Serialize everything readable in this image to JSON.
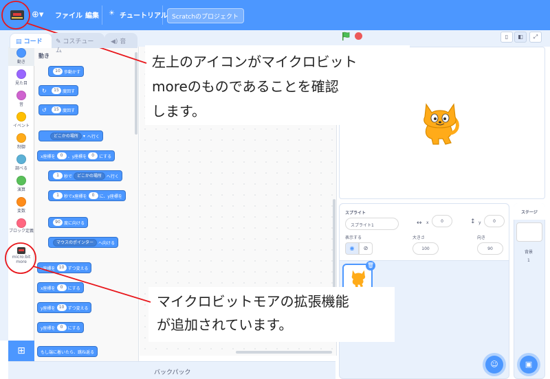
{
  "menubar": {
    "file": "ファイル",
    "edit": "編集",
    "tutorials": "チュートリアル",
    "project_title": "Scratchのプロジェクト",
    "lang_icon": "globe-icon"
  },
  "tabs": {
    "code": "コード",
    "costumes": "コスチューム",
    "sounds": "音"
  },
  "categories": [
    {
      "label": "動き",
      "color": "#4c97ff"
    },
    {
      "label": "見た目",
      "color": "#9966ff"
    },
    {
      "label": "音",
      "color": "#cf63cf"
    },
    {
      "label": "イベント",
      "color": "#ffbf00"
    },
    {
      "label": "制御",
      "color": "#ffab19"
    },
    {
      "label": "調べる",
      "color": "#5cb1d6"
    },
    {
      "label": "演算",
      "color": "#59c059"
    },
    {
      "label": "変数",
      "color": "#ff8c1a"
    },
    {
      "label": "ブロック定義",
      "color": "#ff6680"
    }
  ],
  "extension_category": {
    "label": "micro:bit more",
    "note": "micro:bit more"
  },
  "palette": {
    "heading": "動き",
    "blocks": {
      "move_steps": {
        "value": "10",
        "text": "歩動かす"
      },
      "turn_right": {
        "value": "15",
        "text": "度回す"
      },
      "turn_left": {
        "value": "15",
        "text": "度回す"
      },
      "goto": {
        "dropdown": "どこかの場所",
        "text": "へ行く"
      },
      "goto_xy": {
        "x_label": "x座標を",
        "x": "0",
        "sep": "、y座標を",
        "y": "0",
        "text": "にする"
      },
      "glide": {
        "secs": "1",
        "t1": "秒で",
        "dropdown": "どこかの場所",
        "t2": "へ行く"
      },
      "glide_xy": {
        "secs": "1",
        "t1": "秒でx座標を",
        "x": "0",
        "t2": "に、y座標を"
      },
      "point_dir": {
        "value": "90",
        "text": "度に向ける"
      },
      "point_towards": {
        "dropdown": "マウスのポインター",
        "text": "へ向ける"
      },
      "change_x": {
        "label": "x座標を",
        "value": "10",
        "text": "ずつ変える"
      },
      "set_x": {
        "label": "x座標を",
        "value": "0",
        "text": "にする"
      },
      "change_y": {
        "label": "y座標を",
        "value": "10",
        "text": "ずつ変える"
      },
      "set_y": {
        "label": "y座標を",
        "value": "0",
        "text": "にする"
      },
      "bounce": {
        "text": "もし端に着いたら、跳ね返る"
      }
    }
  },
  "backpack": "バックパック",
  "sprite_info": {
    "heading": "スプライト",
    "name": "スプライト1",
    "x_label": "x",
    "x": "0",
    "y_label": "y",
    "y": "0",
    "show_label": "表示する",
    "size_label": "大きさ",
    "size": "100",
    "direction_label": "向き",
    "direction": "90"
  },
  "stage_pane": {
    "heading": "ステージ",
    "backdrops_label": "背景",
    "backdrops_count": "1"
  },
  "callouts": {
    "top": [
      "左上のアイコンがマイクロビット",
      "moreのものであることを確認",
      "します。"
    ],
    "bottom": [
      "マイクロビットモアの拡張機能",
      "が追加されています。"
    ]
  },
  "colors": {
    "accent": "#4c97ff",
    "annotation": "#e8161b"
  }
}
